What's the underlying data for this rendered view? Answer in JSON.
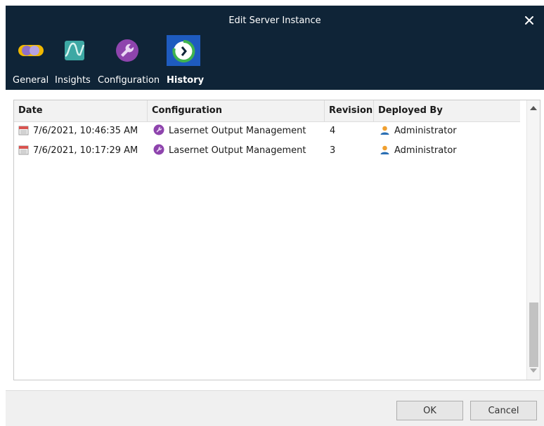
{
  "window": {
    "title": "Edit Server Instance"
  },
  "tabs": [
    {
      "label": "General",
      "icon": "general-icon",
      "active": false
    },
    {
      "label": "Insights",
      "icon": "insights-icon",
      "active": false
    },
    {
      "label": "Configuration",
      "icon": "wrench-icon",
      "active": false
    },
    {
      "label": "History",
      "icon": "history-icon",
      "active": true
    }
  ],
  "table": {
    "columns": [
      "Date",
      "Configuration",
      "Revision",
      "Deployed By"
    ],
    "rows": [
      {
        "date": "7/6/2021, 10:46:35 AM",
        "configuration": "Lasernet Output Management",
        "revision": "4",
        "deployed_by": "Administrator"
      },
      {
        "date": "7/6/2021, 10:17:29 AM",
        "configuration": "Lasernet Output Management",
        "revision": "3",
        "deployed_by": "Administrator"
      }
    ]
  },
  "buttons": {
    "ok": "OK",
    "cancel": "Cancel"
  },
  "colors": {
    "titlebar": "#0f2437",
    "active_tab": "#1e5bbf",
    "accent_purple": "#8e44ad",
    "history_green": "#3fb34f"
  }
}
